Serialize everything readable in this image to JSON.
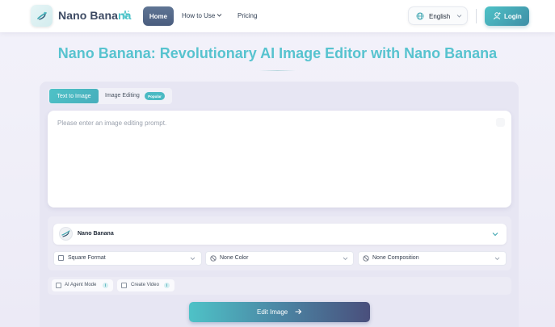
{
  "header": {
    "brand_main": "Nano Bana",
    "brand_accent": "na",
    "nav": {
      "home": "Home",
      "how_to_use": "How to Use",
      "pricing": "Pricing"
    },
    "language": "English",
    "login": "Login"
  },
  "hero": {
    "title": "Nano Banana: Revolutionary AI Image Editor with Nano Banana"
  },
  "editor": {
    "tabs": {
      "text_to_image": "Text to Image",
      "image_editing": "Image Editing",
      "image_editing_badge": "Popular"
    },
    "prompt_placeholder": "Please enter an image editing prompt.",
    "model": "Nano Banana",
    "options": {
      "format": "Square Format",
      "color": "None Color",
      "composition": "None Composition"
    },
    "extras": {
      "agent_mode": "AI Agent Mode",
      "create_video": "Create Video"
    },
    "submit": "Edit Image"
  },
  "colors": {
    "accent": "#4ec2c7",
    "title": "#57c3cf",
    "nav_active": "#4a5d7e"
  },
  "icons": [
    "logo-icon",
    "sparkle-icon",
    "chevron-down-icon",
    "globe-icon",
    "user-icon",
    "model-logo-icon",
    "ban-icon",
    "info-icon",
    "arrow-right-icon"
  ]
}
